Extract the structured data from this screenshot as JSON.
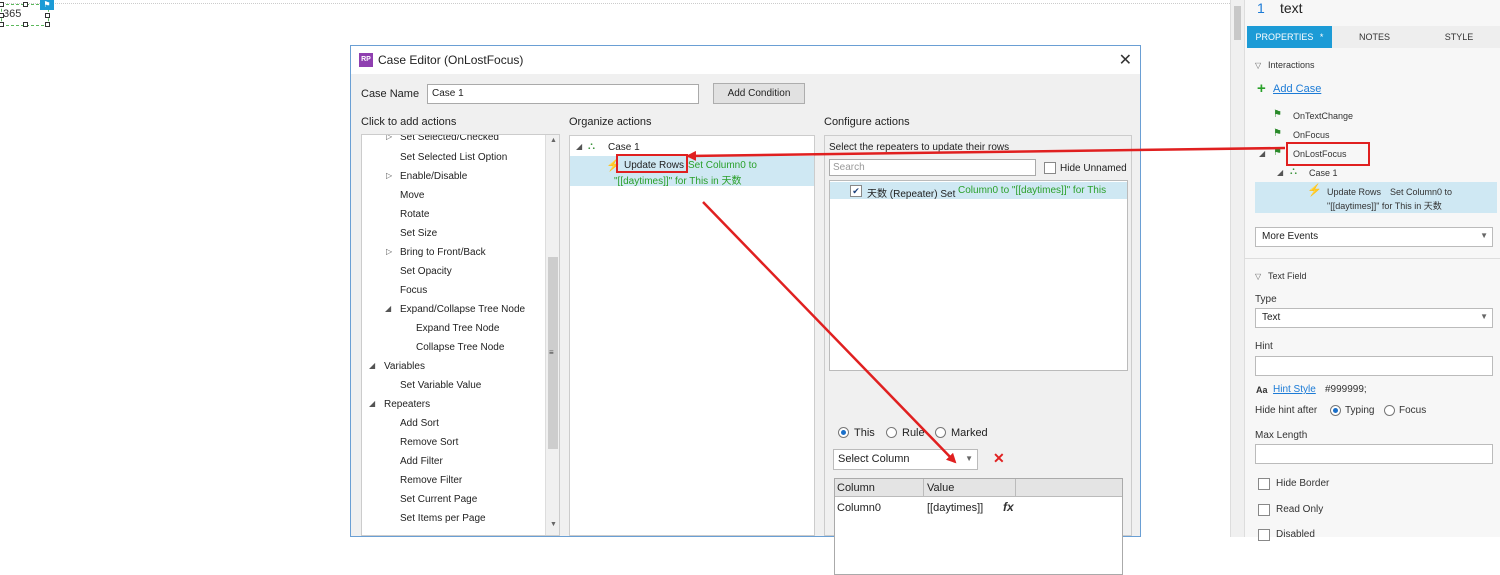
{
  "canvas": {
    "widget_text": "365"
  },
  "dialog": {
    "title": "Case Editor (OnLostFocus)",
    "case_name_label": "Case Name",
    "case_name_value": "Case 1",
    "add_condition": "Add Condition",
    "click_to_add_actions": "Click to add actions",
    "organize_actions": "Organize actions",
    "configure_actions": "Configure actions",
    "actions_list": [
      "Set Selected/Checked",
      "Set Selected List Option",
      "Enable/Disable",
      "Move",
      "Rotate",
      "Set Size",
      "Bring to Front/Back",
      "Set Opacity",
      "Focus",
      "Expand/Collapse Tree Node",
      "Expand Tree Node",
      "Collapse Tree Node",
      "Variables",
      "Set Variable Value",
      "Repeaters",
      "Add Sort",
      "Remove Sort",
      "Add Filter",
      "Remove Filter",
      "Set Current Page",
      "Set Items per Page"
    ],
    "organize": {
      "case": "Case 1",
      "action_name": "Update Rows",
      "action_detail_1": "Set Column0 to",
      "action_detail_2": "\"[[daytimes]]\" for This in 天数"
    },
    "configure": {
      "instruction": "Select the repeaters to update their rows",
      "search_placeholder": "Search",
      "hide_unnamed": "Hide Unnamed",
      "repeater_name": "天数 (Repeater) Set",
      "repeater_detail": "Column0 to \"[[daytimes]]\" for This",
      "radio_this": "This",
      "radio_rule": "Rule",
      "radio_marked": "Marked",
      "select_column": "Select Column",
      "col_header_1": "Column",
      "col_header_2": "Value",
      "row_column": "Column0",
      "row_value": "[[daytimes]]",
      "fx": "fx"
    }
  },
  "rpanel": {
    "item_number": "1",
    "item_name": "text",
    "tabs": [
      "PROPERTIES",
      "NOTES",
      "STYLE"
    ],
    "tab_marker": "*",
    "interactions": "Interactions",
    "add_case": "Add Case",
    "events": [
      "OnTextChange",
      "OnFocus",
      "OnLostFocus"
    ],
    "case": "Case 1",
    "case_action": "Update Rows",
    "case_action_detail_1": "Set Column0 to",
    "case_action_detail_2": "\"[[daytimes]]\" for This in 天数",
    "more_events": "More Events",
    "text_field": "Text Field",
    "type_label": "Type",
    "type_value": "Text",
    "hint_label": "Hint",
    "hint_style_icon": "Aa",
    "hint_style": "Hint Style",
    "hint_color": "#999999;",
    "hide_hint_after": "Hide hint after",
    "typing": "Typing",
    "focus": "Focus",
    "max_length": "Max Length",
    "hide_border": "Hide Border",
    "read_only": "Read Only",
    "disabled": "Disabled"
  },
  "colors": {
    "accent": "#1c9bd6",
    "highlight": "#cfe8f3",
    "annotation": "#e02020",
    "green": "#2aa02a"
  }
}
